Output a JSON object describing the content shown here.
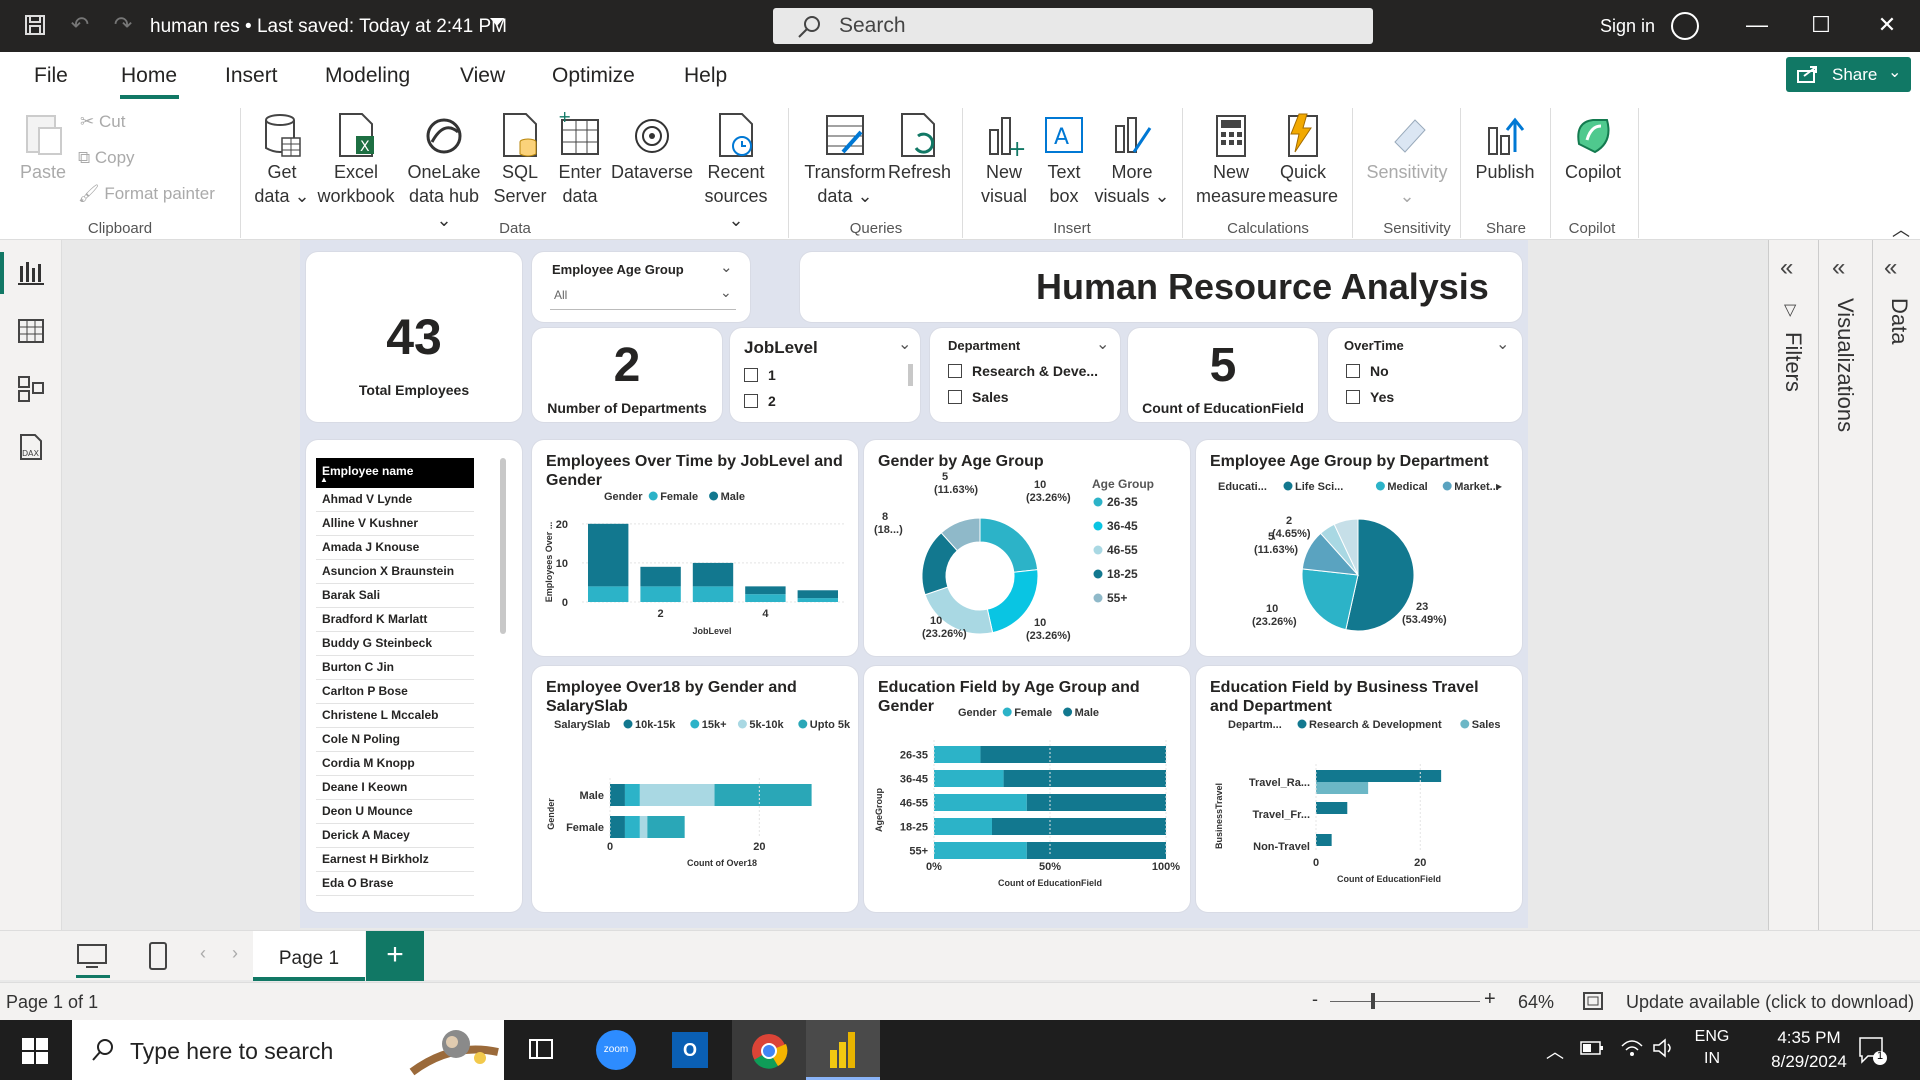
{
  "window": {
    "title": "human res • Last saved: Today at 2:41 PM",
    "search_placeholder": "Search",
    "sign_in": "Sign in"
  },
  "tabs": [
    "File",
    "Home",
    "Insert",
    "Modeling",
    "View",
    "Optimize",
    "Help"
  ],
  "share_label": "Share",
  "ribbon": {
    "clipboard": {
      "paste": "Paste",
      "cut": "Cut",
      "copy": "Copy",
      "format_painter": "Format painter",
      "group": "Clipboard"
    },
    "data": {
      "get_data": [
        "Get",
        "data"
      ],
      "excel": [
        "Excel",
        "workbook"
      ],
      "onelake": [
        "OneLake",
        "data hub"
      ],
      "sql": [
        "SQL",
        "Server"
      ],
      "enter": [
        "Enter",
        "data"
      ],
      "dataverse": "Dataverse",
      "recent": [
        "Recent",
        "sources"
      ],
      "group": "Data"
    },
    "queries": {
      "transform": [
        "Transform",
        "data"
      ],
      "refresh": "Refresh",
      "group": "Queries"
    },
    "insert": {
      "new_visual": [
        "New",
        "visual"
      ],
      "text_box": [
        "Text",
        "box"
      ],
      "more_visuals": [
        "More",
        "visuals"
      ],
      "group": "Insert"
    },
    "calculations": {
      "new_measure": [
        "New",
        "measure"
      ],
      "quick_measure": [
        "Quick",
        "measure"
      ],
      "group": "Calculations"
    },
    "sensitivity": {
      "label": "Sensitivity",
      "group": "Sensitivity"
    },
    "share": {
      "publish": "Publish",
      "group": "Share"
    },
    "copilot": {
      "label": "Copilot",
      "group": "Copilot"
    }
  },
  "report": {
    "title": "Human Resource Analysis",
    "total_employees": {
      "value": "43",
      "label": "Total Employees"
    },
    "departments": {
      "value": "2",
      "label": "Number of Departments"
    },
    "education_count": {
      "value": "5",
      "label": "Count of EducationField"
    },
    "age_slicer": {
      "title": "Employee Age Group",
      "value": "All"
    },
    "joblevel_slicer": {
      "title": "JobLevel",
      "options": [
        "1",
        "2"
      ]
    },
    "department_slicer": {
      "title": "Department",
      "options": [
        "Research & Deve...",
        "Sales"
      ]
    },
    "overtime_slicer": {
      "title": "OverTime",
      "options": [
        "No",
        "Yes"
      ]
    },
    "employee_table": {
      "header": "Employee name",
      "rows": [
        "Ahmad V Lynde",
        "Alline V Kushner",
        "Amada J Knouse",
        "Asuncion X Braunstein",
        "Barak Sali",
        "Bradford K Marlatt",
        "Buddy G Steinbeck",
        "Burton C Jin",
        "Carlton P Bose",
        "Christene L Mccaleb",
        "Cole N Poling",
        "Cordia M Knopp",
        "Deane I Keown",
        "Deon U Mounce",
        "Derick A Macey",
        "Earnest H Birkholz",
        "Eda O Brase"
      ]
    }
  },
  "colors": {
    "dark": "#12788f",
    "mid": "#2cb3c8",
    "light": "#a9d8e3",
    "cyan": "#09c5e3",
    "teal_ui": "#117865"
  },
  "chart_data": [
    {
      "type": "bar",
      "stacked": true,
      "title": "Employees Over Time by JobLevel and Gender",
      "legend_title": "Gender",
      "xlabel": "JobLevel",
      "ylabel": "Employees Over ...",
      "x": [
        1,
        2,
        3,
        4,
        5
      ],
      "x_ticks": [
        "2",
        "4"
      ],
      "y_ticks": [
        "0",
        "10",
        "20"
      ],
      "ylim": [
        0,
        22
      ],
      "series": [
        {
          "name": "Female",
          "values": [
            4,
            4,
            4,
            2,
            1
          ]
        },
        {
          "name": "Male",
          "values": [
            16,
            5,
            6,
            2,
            2
          ]
        }
      ]
    },
    {
      "type": "pie",
      "donut": true,
      "title": "Gender by Age Group",
      "legend_title": "Age Group",
      "categories": [
        "26-35",
        "36-45",
        "46-55",
        "18-25",
        "55+"
      ],
      "values": [
        10,
        10,
        10,
        8,
        5
      ],
      "labels": [
        "10 (23.26%)",
        "10 (23.26%)",
        "10 (23.26%)",
        "8 (18...)",
        "5 (11.63%)"
      ]
    },
    {
      "type": "pie",
      "title": "Employee Age Group by Department",
      "legend_entries": [
        "Educati...",
        "Life Sci...",
        "Medical",
        "Market..."
      ],
      "values": [
        23,
        10,
        5,
        2,
        3
      ],
      "labels": [
        "23 (53.49%)",
        "10 (23.26%)",
        "5 (11.63%)",
        "2 (4.65%)",
        ""
      ]
    },
    {
      "type": "bar",
      "orientation": "horizontal",
      "stacked": true,
      "title": "Employee Over18 by Gender and SalarySlab",
      "legend_title": "SalarySlab",
      "xlabel": "Count of Over18",
      "ylabel": "Gender",
      "categories": [
        "Male",
        "Female"
      ],
      "x_ticks": [
        "0",
        "20"
      ],
      "xlim": [
        0,
        30
      ],
      "series": [
        {
          "name": "10k-15k",
          "values": [
            2,
            2
          ]
        },
        {
          "name": "15k+",
          "values": [
            2,
            2
          ]
        },
        {
          "name": "5k-10k",
          "values": [
            10,
            1
          ]
        },
        {
          "name": "Upto 5k",
          "values": [
            13,
            5
          ]
        }
      ]
    },
    {
      "type": "bar",
      "orientation": "horizontal",
      "stacked": true,
      "percent": true,
      "title": "Education Field by Age Group and Gender",
      "legend_title": "Gender",
      "xlabel": "Count of EducationField",
      "ylabel": "AgeGroup",
      "categories": [
        "26-35",
        "36-45",
        "46-55",
        "18-25",
        "55+"
      ],
      "x_ticks": [
        "0%",
        "50%",
        "100%"
      ],
      "series": [
        {
          "name": "Female",
          "values": [
            20,
            30,
            40,
            25,
            40
          ]
        },
        {
          "name": "Male",
          "values": [
            80,
            70,
            60,
            75,
            60
          ]
        }
      ]
    },
    {
      "type": "bar",
      "orientation": "horizontal",
      "title": "Education Field by Business Travel and Department",
      "legend_title": "Departm...",
      "xlabel": "Count of EducationField",
      "ylabel": "BusinessTravel",
      "categories": [
        "Travel_Ra...",
        "Travel_Fr...",
        "Non-Travel"
      ],
      "x_ticks": [
        "0",
        "20"
      ],
      "xlim": [
        0,
        28
      ],
      "series": [
        {
          "name": "Research & Development",
          "values": [
            24,
            6,
            3
          ]
        },
        {
          "name": "Sales",
          "values": [
            10,
            0,
            0
          ]
        }
      ]
    }
  ],
  "side_panes": [
    "Filters",
    "Visualizations",
    "Data"
  ],
  "pages": {
    "tab": "Page 1",
    "add": "+"
  },
  "status": {
    "page": "Page 1 of 1",
    "zoom": "64%",
    "update": "Update available (click to download)"
  },
  "taskbar": {
    "search": "Type here to search",
    "lang1": "ENG",
    "lang2": "IN",
    "time": "4:35 PM",
    "date": "8/29/2024",
    "zoom_app": "zoom",
    "notif": "1"
  }
}
